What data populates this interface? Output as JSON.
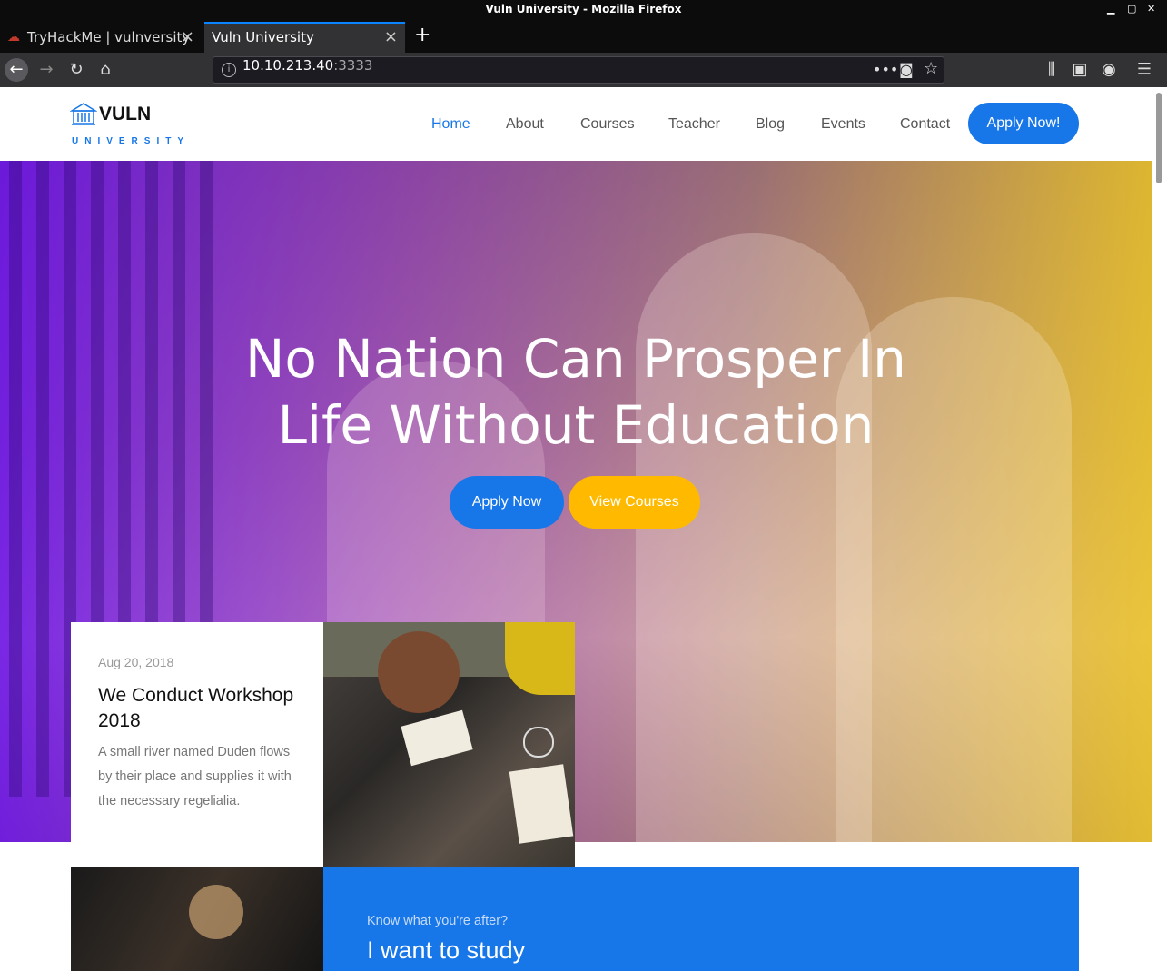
{
  "window": {
    "title": "Vuln University - Mozilla Firefox"
  },
  "tabs": [
    {
      "label": "TryHackMe | vulnversity"
    },
    {
      "label": "Vuln University"
    }
  ],
  "address": {
    "host": "10.10.213.40",
    "port": ":3333"
  },
  "site": {
    "logo_name": "VULN",
    "logo_sub": "UNIVERSITY",
    "nav": [
      "Home",
      "About",
      "Courses",
      "Teacher",
      "Blog",
      "Events",
      "Contact"
    ],
    "apply_label": "Apply Now!"
  },
  "hero": {
    "heading_line1": "No Nation Can Prosper In",
    "heading_line2": "Life Without Education",
    "btn_apply": "Apply Now",
    "btn_courses": "View Courses"
  },
  "event_card": {
    "date": "Aug 20, 2018",
    "title": "We Conduct Workshop 2018",
    "desc": "A small river named Duden flows by their place and supplies it with the necessary regelialia."
  },
  "cta": {
    "kicker": "Know what you're after?",
    "headline": "I want to study"
  },
  "colors": {
    "accent": "#1877e8",
    "yellow": "#ffba00"
  }
}
